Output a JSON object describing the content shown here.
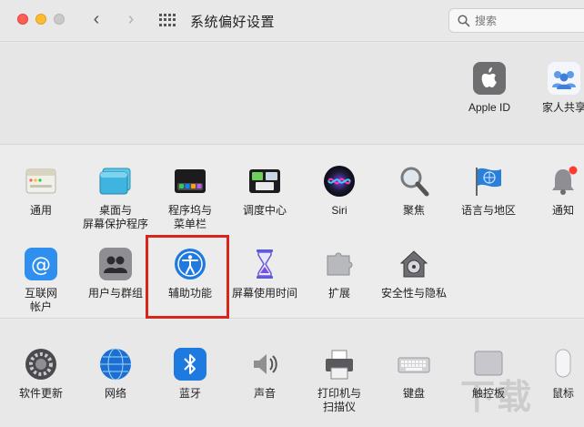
{
  "window": {
    "title": "系统偏好设置"
  },
  "search": {
    "placeholder": "搜索"
  },
  "top_items": [
    {
      "label": "Apple ID"
    },
    {
      "label": "家人共享"
    }
  ],
  "row1": [
    {
      "label": "通用"
    },
    {
      "label": "桌面与\n屏幕保护程序"
    },
    {
      "label": "程序坞与\n菜单栏"
    },
    {
      "label": "调度中心"
    },
    {
      "label": "Siri"
    },
    {
      "label": "聚焦"
    },
    {
      "label": "语言与地区"
    },
    {
      "label": "通知"
    }
  ],
  "row2": [
    {
      "label": "互联网\n帐户"
    },
    {
      "label": "用户与群组"
    },
    {
      "label": "辅助功能"
    },
    {
      "label": "屏幕使用时间"
    },
    {
      "label": "扩展"
    },
    {
      "label": "安全性与隐私"
    }
  ],
  "row3": [
    {
      "label": "软件更新"
    },
    {
      "label": "网络"
    },
    {
      "label": "蓝牙"
    },
    {
      "label": "声音"
    },
    {
      "label": "打印机与\n扫描仪"
    },
    {
      "label": "键盘"
    },
    {
      "label": "触控板"
    },
    {
      "label": "鼠标"
    }
  ],
  "watermark": "下载"
}
